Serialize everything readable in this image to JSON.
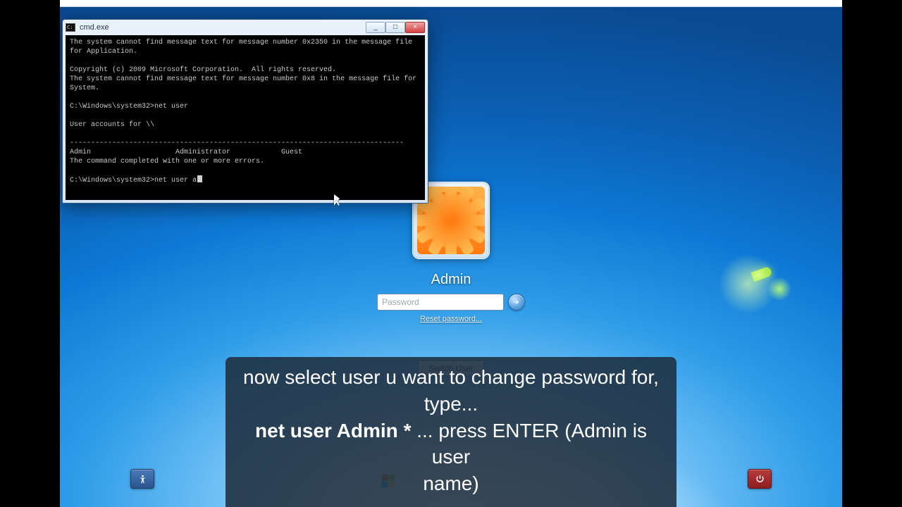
{
  "cmd": {
    "title": "cmd.exe",
    "btn_min": "_",
    "btn_max": "□",
    "btn_close": "×",
    "line1": "The system cannot find message text for message number 0x2350 in the message file for Application.",
    "blank1": "",
    "line2": "Copyright (c) 2009 Microsoft Corporation.  All rights reserved.",
    "line3": "The system cannot find message text for message number 0x8 in the message file for System.",
    "blank2": "",
    "prompt1": "C:\\Windows\\system32>net user",
    "blank3": "",
    "line4": "User accounts for \\\\",
    "blank4": "",
    "rule": "-------------------------------------------------------------------------------",
    "cols": "Admin                    Administrator            Guest",
    "line5": "The command completed with one or more errors.",
    "blank5": "",
    "prompt2": "C:\\Windows\\system32>net user a"
  },
  "login": {
    "username": "Admin",
    "password_placeholder": "Password",
    "reset": "Reset password...",
    "switch": "Switch User",
    "brand": "Windows 7 Professional"
  },
  "caption": {
    "l1": "now select user u want to change password for, type...",
    "l2a": "net user Admin *",
    "l2b": " ... press ENTER (Admin is user",
    "l3": "name)"
  }
}
